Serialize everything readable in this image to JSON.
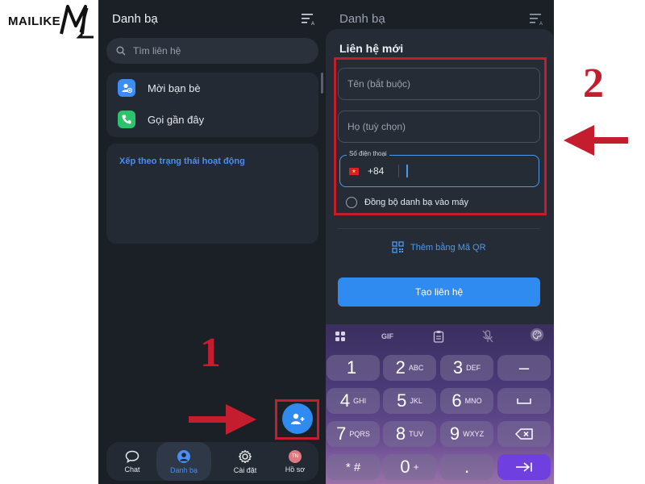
{
  "logo": {
    "text": "MAILIKE"
  },
  "left_phone": {
    "header_title": "Danh bạ",
    "search_placeholder": "Tìm liên hệ",
    "menu": [
      {
        "label": "Mời bạn bè",
        "icon": "add-user-icon",
        "color": "#3b8ef5"
      },
      {
        "label": "Gọi gần đây",
        "icon": "phone-icon",
        "color": "#2cc36b"
      }
    ],
    "status_label": "Xếp theo trạng thái hoạt động",
    "nav": [
      {
        "label": "Chat",
        "icon": "chat-icon"
      },
      {
        "label": "Danh bạ",
        "icon": "contacts-icon",
        "active": true
      },
      {
        "label": "Cài đặt",
        "icon": "gear-icon"
      },
      {
        "label": "Hồ sơ",
        "icon": "avatar",
        "avatar_text": "TN"
      }
    ]
  },
  "annotations": {
    "step1": "1",
    "step2": "2",
    "accent": "#c41e2e"
  },
  "right_phone": {
    "header_title": "Danh bạ",
    "sheet_title": "Liên hệ mới",
    "name_placeholder": "Tên (bắt buộc)",
    "lastname_placeholder": "Họ (tuỳ chọn)",
    "phone_legend": "Số điện thoại",
    "dial_code": "+84",
    "sync_label": "Đồng bộ danh bạ vào máy",
    "qr_label": "Thêm bằng Mã QR",
    "create_button": "Tạo liên hệ"
  },
  "keyboard": {
    "toolbar": [
      "apps-icon",
      "GIF",
      "clipboard-icon",
      "mic-off-icon",
      "palette-icon"
    ],
    "gif_label": "GIF",
    "rows": [
      [
        {
          "main": "1",
          "sub": ""
        },
        {
          "main": "2",
          "sub": "ABC"
        },
        {
          "main": "3",
          "sub": "DEF"
        },
        {
          "main": "–",
          "sub": ""
        }
      ],
      [
        {
          "main": "4",
          "sub": "GHI"
        },
        {
          "main": "5",
          "sub": "JKL"
        },
        {
          "main": "6",
          "sub": "MNO"
        },
        {
          "main": "␣",
          "sub": ""
        }
      ],
      [
        {
          "main": "7",
          "sub": "PQRS"
        },
        {
          "main": "8",
          "sub": "TUV"
        },
        {
          "main": "9",
          "sub": "WXYZ"
        },
        {
          "main": "⌫",
          "sub": ""
        }
      ],
      [
        {
          "main": "* #",
          "sub": ""
        },
        {
          "main": "0",
          "sub": "+"
        },
        {
          "main": ".",
          "sub": ""
        },
        {
          "main": "→|",
          "sub": ""
        }
      ]
    ]
  }
}
